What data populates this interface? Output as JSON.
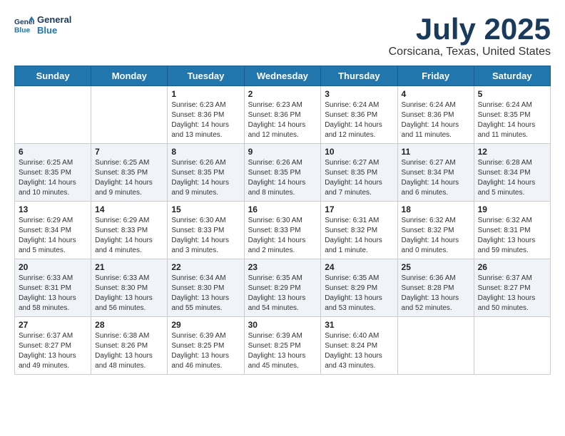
{
  "header": {
    "logo_line1": "General",
    "logo_line2": "Blue",
    "month": "July 2025",
    "location": "Corsicana, Texas, United States"
  },
  "days_of_week": [
    "Sunday",
    "Monday",
    "Tuesday",
    "Wednesday",
    "Thursday",
    "Friday",
    "Saturday"
  ],
  "weeks": [
    [
      {
        "day": "",
        "sunrise": "",
        "sunset": "",
        "daylight": ""
      },
      {
        "day": "",
        "sunrise": "",
        "sunset": "",
        "daylight": ""
      },
      {
        "day": "1",
        "sunrise": "Sunrise: 6:23 AM",
        "sunset": "Sunset: 8:36 PM",
        "daylight": "Daylight: 14 hours and 13 minutes."
      },
      {
        "day": "2",
        "sunrise": "Sunrise: 6:23 AM",
        "sunset": "Sunset: 8:36 PM",
        "daylight": "Daylight: 14 hours and 12 minutes."
      },
      {
        "day": "3",
        "sunrise": "Sunrise: 6:24 AM",
        "sunset": "Sunset: 8:36 PM",
        "daylight": "Daylight: 14 hours and 12 minutes."
      },
      {
        "day": "4",
        "sunrise": "Sunrise: 6:24 AM",
        "sunset": "Sunset: 8:36 PM",
        "daylight": "Daylight: 14 hours and 11 minutes."
      },
      {
        "day": "5",
        "sunrise": "Sunrise: 6:24 AM",
        "sunset": "Sunset: 8:35 PM",
        "daylight": "Daylight: 14 hours and 11 minutes."
      }
    ],
    [
      {
        "day": "6",
        "sunrise": "Sunrise: 6:25 AM",
        "sunset": "Sunset: 8:35 PM",
        "daylight": "Daylight: 14 hours and 10 minutes."
      },
      {
        "day": "7",
        "sunrise": "Sunrise: 6:25 AM",
        "sunset": "Sunset: 8:35 PM",
        "daylight": "Daylight: 14 hours and 9 minutes."
      },
      {
        "day": "8",
        "sunrise": "Sunrise: 6:26 AM",
        "sunset": "Sunset: 8:35 PM",
        "daylight": "Daylight: 14 hours and 9 minutes."
      },
      {
        "day": "9",
        "sunrise": "Sunrise: 6:26 AM",
        "sunset": "Sunset: 8:35 PM",
        "daylight": "Daylight: 14 hours and 8 minutes."
      },
      {
        "day": "10",
        "sunrise": "Sunrise: 6:27 AM",
        "sunset": "Sunset: 8:35 PM",
        "daylight": "Daylight: 14 hours and 7 minutes."
      },
      {
        "day": "11",
        "sunrise": "Sunrise: 6:27 AM",
        "sunset": "Sunset: 8:34 PM",
        "daylight": "Daylight: 14 hours and 6 minutes."
      },
      {
        "day": "12",
        "sunrise": "Sunrise: 6:28 AM",
        "sunset": "Sunset: 8:34 PM",
        "daylight": "Daylight: 14 hours and 5 minutes."
      }
    ],
    [
      {
        "day": "13",
        "sunrise": "Sunrise: 6:29 AM",
        "sunset": "Sunset: 8:34 PM",
        "daylight": "Daylight: 14 hours and 5 minutes."
      },
      {
        "day": "14",
        "sunrise": "Sunrise: 6:29 AM",
        "sunset": "Sunset: 8:33 PM",
        "daylight": "Daylight: 14 hours and 4 minutes."
      },
      {
        "day": "15",
        "sunrise": "Sunrise: 6:30 AM",
        "sunset": "Sunset: 8:33 PM",
        "daylight": "Daylight: 14 hours and 3 minutes."
      },
      {
        "day": "16",
        "sunrise": "Sunrise: 6:30 AM",
        "sunset": "Sunset: 8:33 PM",
        "daylight": "Daylight: 14 hours and 2 minutes."
      },
      {
        "day": "17",
        "sunrise": "Sunrise: 6:31 AM",
        "sunset": "Sunset: 8:32 PM",
        "daylight": "Daylight: 14 hours and 1 minute."
      },
      {
        "day": "18",
        "sunrise": "Sunrise: 6:32 AM",
        "sunset": "Sunset: 8:32 PM",
        "daylight": "Daylight: 14 hours and 0 minutes."
      },
      {
        "day": "19",
        "sunrise": "Sunrise: 6:32 AM",
        "sunset": "Sunset: 8:31 PM",
        "daylight": "Daylight: 13 hours and 59 minutes."
      }
    ],
    [
      {
        "day": "20",
        "sunrise": "Sunrise: 6:33 AM",
        "sunset": "Sunset: 8:31 PM",
        "daylight": "Daylight: 13 hours and 58 minutes."
      },
      {
        "day": "21",
        "sunrise": "Sunrise: 6:33 AM",
        "sunset": "Sunset: 8:30 PM",
        "daylight": "Daylight: 13 hours and 56 minutes."
      },
      {
        "day": "22",
        "sunrise": "Sunrise: 6:34 AM",
        "sunset": "Sunset: 8:30 PM",
        "daylight": "Daylight: 13 hours and 55 minutes."
      },
      {
        "day": "23",
        "sunrise": "Sunrise: 6:35 AM",
        "sunset": "Sunset: 8:29 PM",
        "daylight": "Daylight: 13 hours and 54 minutes."
      },
      {
        "day": "24",
        "sunrise": "Sunrise: 6:35 AM",
        "sunset": "Sunset: 8:29 PM",
        "daylight": "Daylight: 13 hours and 53 minutes."
      },
      {
        "day": "25",
        "sunrise": "Sunrise: 6:36 AM",
        "sunset": "Sunset: 8:28 PM",
        "daylight": "Daylight: 13 hours and 52 minutes."
      },
      {
        "day": "26",
        "sunrise": "Sunrise: 6:37 AM",
        "sunset": "Sunset: 8:27 PM",
        "daylight": "Daylight: 13 hours and 50 minutes."
      }
    ],
    [
      {
        "day": "27",
        "sunrise": "Sunrise: 6:37 AM",
        "sunset": "Sunset: 8:27 PM",
        "daylight": "Daylight: 13 hours and 49 minutes."
      },
      {
        "day": "28",
        "sunrise": "Sunrise: 6:38 AM",
        "sunset": "Sunset: 8:26 PM",
        "daylight": "Daylight: 13 hours and 48 minutes."
      },
      {
        "day": "29",
        "sunrise": "Sunrise: 6:39 AM",
        "sunset": "Sunset: 8:25 PM",
        "daylight": "Daylight: 13 hours and 46 minutes."
      },
      {
        "day": "30",
        "sunrise": "Sunrise: 6:39 AM",
        "sunset": "Sunset: 8:25 PM",
        "daylight": "Daylight: 13 hours and 45 minutes."
      },
      {
        "day": "31",
        "sunrise": "Sunrise: 6:40 AM",
        "sunset": "Sunset: 8:24 PM",
        "daylight": "Daylight: 13 hours and 43 minutes."
      },
      {
        "day": "",
        "sunrise": "",
        "sunset": "",
        "daylight": ""
      },
      {
        "day": "",
        "sunrise": "",
        "sunset": "",
        "daylight": ""
      }
    ]
  ]
}
